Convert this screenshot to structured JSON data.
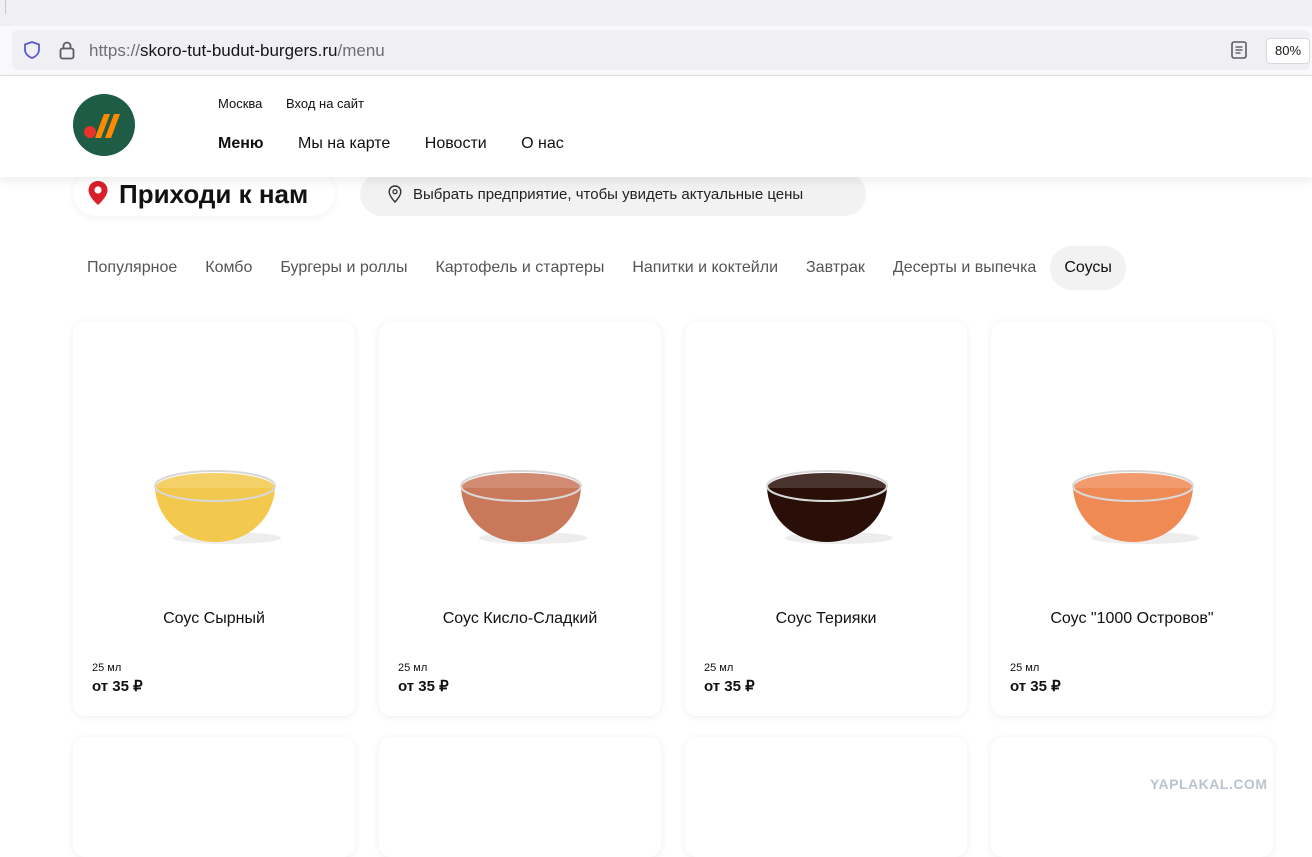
{
  "browser": {
    "url_prefix": "https://",
    "url_host": "skoro-tut-budut-burgers.ru",
    "url_path": "/menu",
    "zoom": "80%"
  },
  "header": {
    "city": "Москва",
    "login": "Вход на сайт",
    "nav": [
      "Меню",
      "Мы на карте",
      "Новости",
      "О нас"
    ],
    "brand_colors": {
      "green": "#1f5c45",
      "orange": "#ff8a00",
      "red": "#e8332a"
    }
  },
  "location": {
    "title": "Приходи к нам",
    "store_prompt": "Выбрать предприятие, чтобы увидеть актуальные цены"
  },
  "categories": [
    "Популярное",
    "Комбо",
    "Бургеры и роллы",
    "Картофель и стартеры",
    "Напитки и коктейли",
    "Завтрак",
    "Десерты и выпечка",
    "Соусы"
  ],
  "active_category": "Соусы",
  "products": [
    {
      "name": "Соус Сырный",
      "size": "25 мл",
      "price": "от 35 ₽",
      "color": "#f2c94c"
    },
    {
      "name": "Соус Кисло-Сладкий",
      "size": "25 мл",
      "price": "от 35 ₽",
      "color": "#c9785a"
    },
    {
      "name": "Соус Терияки",
      "size": "25 мл",
      "price": "от 35 ₽",
      "color": "#2a0e08"
    },
    {
      "name": "Соус \"1000 Островов\"",
      "size": "25 мл",
      "price": "от 35 ₽",
      "color": "#f08a55"
    }
  ],
  "watermark": "YAPLAKAL.COM"
}
